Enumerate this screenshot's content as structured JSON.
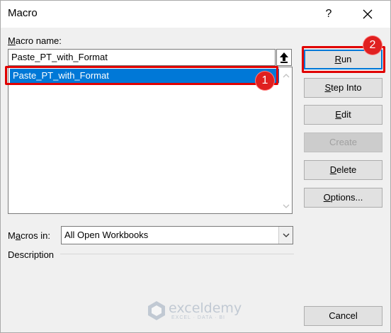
{
  "window": {
    "title": "Macro",
    "help": "?",
    "close_icon": "close-icon"
  },
  "macro_name": {
    "label_prefix": "",
    "label_access": "M",
    "label_rest": "acro name:",
    "value": "Paste_PT_with_Format"
  },
  "macro_list": {
    "items": [
      "Paste_PT_with_Format"
    ],
    "selected_index": 0
  },
  "buttons": {
    "run": {
      "access": "R",
      "rest": "un"
    },
    "step_into": {
      "access": "S",
      "rest": "tep Into"
    },
    "edit": {
      "access": "E",
      "rest": "dit"
    },
    "create": "Create",
    "delete": {
      "access": "D",
      "rest": "elete"
    },
    "options": {
      "access": "O",
      "rest": "ptions..."
    },
    "cancel": "Cancel"
  },
  "macros_in": {
    "label_pre": "M",
    "label_access": "a",
    "label_rest": "cros in:",
    "value": "All Open Workbooks"
  },
  "description": {
    "label": "Description"
  },
  "annotations": {
    "badge1": "1",
    "badge2": "2",
    "accent": "#e00000"
  },
  "watermark": {
    "name": "exceldemy",
    "tagline": "EXCEL · DATA · BI"
  }
}
